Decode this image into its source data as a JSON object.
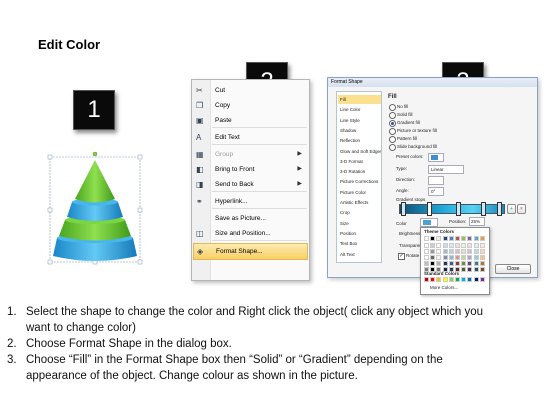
{
  "title": "Edit Color",
  "badges": [
    "1",
    "2",
    "3"
  ],
  "context_menu": {
    "items": [
      {
        "label": "Cut",
        "icon": "scissors-icon",
        "glyph": "✂"
      },
      {
        "label": "Copy",
        "icon": "copy-icon",
        "glyph": "❐"
      },
      {
        "label": "Paste",
        "icon": "paste-icon",
        "glyph": "▣"
      },
      {
        "label": "Edit Text",
        "icon": "edit-text-icon",
        "glyph": "A"
      },
      {
        "label": "Group",
        "icon": "group-icon",
        "glyph": "▦",
        "disabled": true,
        "submenu": true
      },
      {
        "label": "Bring to Front",
        "icon": "bring-to-front-icon",
        "glyph": "◧",
        "submenu": true
      },
      {
        "label": "Send to Back",
        "icon": "send-to-back-icon",
        "glyph": "◨",
        "submenu": true
      },
      {
        "label": "Hyperlink...",
        "icon": "hyperlink-icon",
        "glyph": "⚭"
      },
      {
        "label": "Save as Picture...",
        "icon": "",
        "glyph": ""
      },
      {
        "label": "Size and Position...",
        "icon": "size-position-icon",
        "glyph": "◫"
      },
      {
        "label": "Format Shape...",
        "icon": "format-shape-icon",
        "glyph": "◈",
        "highlighted": true
      }
    ]
  },
  "dialog": {
    "title": "Format Shape",
    "nav": [
      "Fill",
      "Line Color",
      "Line Style",
      "Shadow",
      "Reflection",
      "Glow and Soft Edges",
      "3-D Format",
      "3-D Rotation",
      "Picture Corrections",
      "Picture Color",
      "Artistic Effects",
      "Crop",
      "Size",
      "Position",
      "Text Box",
      "Alt Text"
    ],
    "section": "Fill",
    "fill_options": [
      "No fill",
      "Solid fill",
      "Gradient fill",
      "Picture or texture fill",
      "Pattern fill",
      "Slide background fill"
    ],
    "selected_fill": 2,
    "preset_colors_label": "Preset colors:",
    "type_label": "Type:",
    "type_value": "Linear",
    "direction_label": "Direction:",
    "angle_label": "Angle:",
    "angle_value": "0°",
    "gradient_stops_label": "Gradient stops",
    "color_label": "Color",
    "position_label": "Position:",
    "position_value": "25%",
    "brightness_label": "Brightness:",
    "transparency_label": "Transparency:",
    "rotate_label": "Rotate with shape",
    "close_button": "Close"
  },
  "palette": {
    "theme_title": "Theme Colors",
    "standard_title": "Standard Colors",
    "more_colors": "More Colors...",
    "theme_top": [
      "#ffffff",
      "#000000",
      "#eeece1",
      "#1f497d",
      "#4f81bd",
      "#c0504d",
      "#9bbb59",
      "#8064a2",
      "#4bacc6",
      "#f79646"
    ],
    "standard": [
      "#c00000",
      "#ff0000",
      "#ffc000",
      "#ffff00",
      "#92d050",
      "#00b050",
      "#00b0f0",
      "#0070c0",
      "#002060",
      "#7030a0"
    ]
  },
  "instructions": [
    {
      "num": "1.",
      "lines": [
        "Select the shape to change the color and Right click the object( click any object which you",
        "want to change color)"
      ]
    },
    {
      "num": "2.",
      "lines": [
        "Choose Format Shape in the dialog box."
      ]
    },
    {
      "num": "3.",
      "lines": [
        "Choose “Fill” in the Format Shape box then “Solid” or “Gradient” depending on the",
        "appearance of the object. Change colour as shown in the picture."
      ]
    }
  ],
  "colors": {
    "pyramid_green": "#6cc832",
    "pyramid_blue": "#2fa9e6",
    "menu_highlight": "#f8cf65"
  }
}
